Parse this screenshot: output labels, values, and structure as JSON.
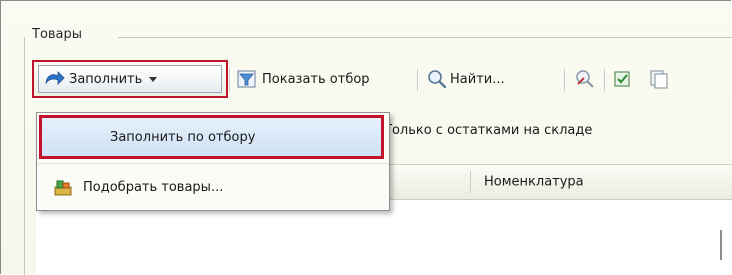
{
  "group": {
    "title": "Товары"
  },
  "toolbar": {
    "fill_label": "Заполнить",
    "show_filter_label": "Показать отбор",
    "find_label": "Найти..."
  },
  "menu": {
    "items": [
      {
        "label": "Заполнить по отбору"
      },
      {
        "label": "Подобрать товары..."
      }
    ]
  },
  "filter": {
    "only_in_stock_label": "Только с остатками на складе"
  },
  "table": {
    "columns": [
      "Номенклатура"
    ]
  },
  "colors": {
    "highlight": "#c3122b",
    "accent": "#2b74c7"
  },
  "icons": [
    "fill-arrow-icon",
    "dropdown-caret-icon",
    "show-filter-icon",
    "search-icon",
    "clear-filter-icon",
    "checklist-icon",
    "pick-products-icon"
  ]
}
